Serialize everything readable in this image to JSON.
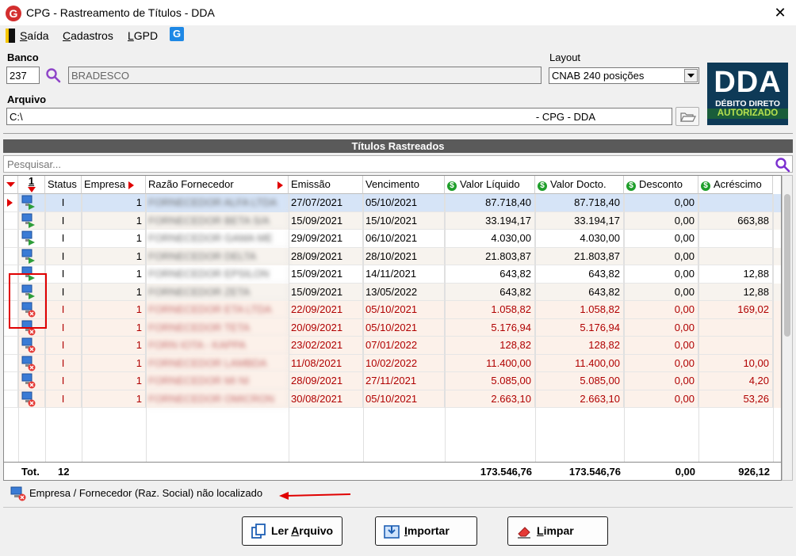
{
  "window": {
    "title": "CPG - Rastreamento de Títulos - DDA",
    "close": "✕"
  },
  "menu": {
    "items": [
      {
        "pre": "",
        "accel": "S",
        "post": "aída"
      },
      {
        "pre": "",
        "accel": "C",
        "post": "adastros"
      },
      {
        "pre": "",
        "accel": "L",
        "post": "GPD"
      }
    ],
    "logo_letter": "G"
  },
  "banco": {
    "label": "Banco",
    "code": "237",
    "name": "BRADESCO"
  },
  "layout": {
    "label": "Layout",
    "value": "CNAB 240 posições"
  },
  "arquivo": {
    "label": "Arquivo",
    "prefix": "C:\\",
    "suffix": "- CPG - DDA"
  },
  "dda_logo": {
    "big": "DDA",
    "line1": "DÉBITO DIRETO",
    "line2": "AUTORIZADO"
  },
  "grid": {
    "title": "Títulos Rastreados",
    "search_placeholder": "Pesquisar...",
    "sort_num": "1",
    "headers": [
      "Status",
      "Empresa",
      "Razão Fornecedor",
      "Emissão",
      "Vencimento",
      "Valor Líquido",
      "Valor Docto.",
      "Desconto",
      "Acréscimo"
    ],
    "rows": [
      {
        "type": "ok",
        "status": "I",
        "empresa": "1",
        "fornecedor": "FORNECEDOR ALFA LTDA",
        "emissao": "27/07/2021",
        "vencimento": "05/10/2021",
        "liquido": "87.718,40",
        "docto": "87.718,40",
        "desconto": "0,00",
        "acrescimo": ""
      },
      {
        "type": "ok",
        "status": "I",
        "empresa": "1",
        "fornecedor": "FORNECEDOR BETA S/A",
        "emissao": "15/09/2021",
        "vencimento": "15/10/2021",
        "liquido": "33.194,17",
        "docto": "33.194,17",
        "desconto": "0,00",
        "acrescimo": "663,88"
      },
      {
        "type": "ok",
        "status": "I",
        "empresa": "1",
        "fornecedor": "FORNECEDOR GAMA ME",
        "emissao": "29/09/2021",
        "vencimento": "06/10/2021",
        "liquido": "4.030,00",
        "docto": "4.030,00",
        "desconto": "0,00",
        "acrescimo": ""
      },
      {
        "type": "ok",
        "status": "I",
        "empresa": "1",
        "fornecedor": "FORNECEDOR DELTA",
        "emissao": "28/09/2021",
        "vencimento": "28/10/2021",
        "liquido": "21.803,87",
        "docto": "21.803,87",
        "desconto": "0,00",
        "acrescimo": ""
      },
      {
        "type": "ok",
        "status": "I",
        "empresa": "1",
        "fornecedor": "FORNECEDOR EPSILON",
        "emissao": "15/09/2021",
        "vencimento": "14/11/2021",
        "liquido": "643,82",
        "docto": "643,82",
        "desconto": "0,00",
        "acrescimo": "12,88"
      },
      {
        "type": "ok",
        "status": "I",
        "empresa": "1",
        "fornecedor": "FORNECEDOR ZETA",
        "emissao": "15/09/2021",
        "vencimento": "13/05/2022",
        "liquido": "643,82",
        "docto": "643,82",
        "desconto": "0,00",
        "acrescimo": "12,88"
      },
      {
        "type": "err",
        "status": "I",
        "empresa": "1",
        "fornecedor": "FORNECEDOR ETA LTDA",
        "emissao": "22/09/2021",
        "vencimento": "05/10/2021",
        "liquido": "1.058,82",
        "docto": "1.058,82",
        "desconto": "0,00",
        "acrescimo": "169,02"
      },
      {
        "type": "err",
        "status": "I",
        "empresa": "1",
        "fornecedor": "FORNECEDOR TETA",
        "emissao": "20/09/2021",
        "vencimento": "05/10/2021",
        "liquido": "5.176,94",
        "docto": "5.176,94",
        "desconto": "0,00",
        "acrescimo": ""
      },
      {
        "type": "err",
        "status": "I",
        "empresa": "1",
        "fornecedor": "FORN IOTA - KAPPA",
        "emissao": "23/02/2021",
        "vencimento": "07/01/2022",
        "liquido": "128,82",
        "docto": "128,82",
        "desconto": "0,00",
        "acrescimo": ""
      },
      {
        "type": "err",
        "status": "I",
        "empresa": "1",
        "fornecedor": "FORNECEDOR LAMBDA",
        "emissao": "11/08/2021",
        "vencimento": "10/02/2022",
        "liquido": "11.400,00",
        "docto": "11.400,00",
        "desconto": "0,00",
        "acrescimo": "10,00"
      },
      {
        "type": "err",
        "status": "I",
        "empresa": "1",
        "fornecedor": "FORNECEDOR MI NI",
        "emissao": "28/09/2021",
        "vencimento": "27/11/2021",
        "liquido": "5.085,00",
        "docto": "5.085,00",
        "desconto": "0,00",
        "acrescimo": "4,20"
      },
      {
        "type": "err",
        "status": "I",
        "empresa": "1",
        "fornecedor": "FORNECEDOR OMICRON",
        "emissao": "30/08/2021",
        "vencimento": "05/10/2021",
        "liquido": "2.663,10",
        "docto": "2.663,10",
        "desconto": "0,00",
        "acrescimo": "53,26"
      }
    ],
    "totals": {
      "label": "Tot.",
      "count": "12",
      "liquido": "173.546,76",
      "docto": "173.546,76",
      "desconto": "0,00",
      "acrescimo": "926,12"
    }
  },
  "legend": "Empresa / Fornecedor (Raz. Social) não localizado",
  "buttons": {
    "ler": {
      "pre": "Ler ",
      "accel": "A",
      "post": "rquivo"
    },
    "importar": {
      "pre": "",
      "accel": "I",
      "post": "mportar"
    },
    "limpar": {
      "pre": "",
      "accel": "L",
      "post": "impar"
    }
  },
  "colors": {
    "error_text": "#b00000",
    "selected_row": "#d6e4f7",
    "error_row": "#fcf1ea",
    "accent": "#1e88e5"
  }
}
